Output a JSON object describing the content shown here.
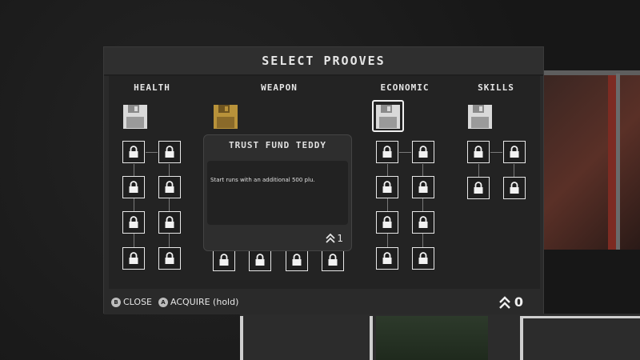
{
  "panel": {
    "title": "SELECT PROOVES"
  },
  "categories": [
    {
      "name": "HEALTH"
    },
    {
      "name": "WEAPON"
    },
    {
      "name": "ECONOMIC"
    },
    {
      "name": "SKILLS"
    }
  ],
  "tooltip": {
    "title": "TRUST FUND TEDDY",
    "description": "Start runs with an additional 500 plu.",
    "cost": "1"
  },
  "footer": {
    "close_glyph": "B",
    "close_label": "CLOSE",
    "acquire_glyph": "A",
    "acquire_label": "ACQUIRE (hold)",
    "currency_value": "0"
  },
  "icons": {
    "floppy": "floppy-disk-icon",
    "lock": "lock-icon",
    "chevron": "double-chevron-up-icon"
  },
  "colors": {
    "floppy_normal": "#d9d9d9",
    "floppy_weapon": "#b8923a"
  }
}
